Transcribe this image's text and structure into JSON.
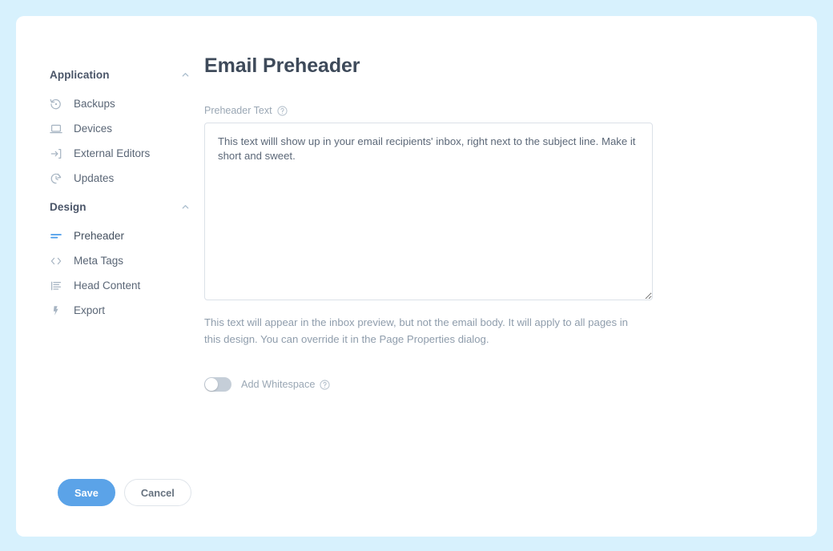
{
  "theme": {
    "page_background": "#d7f1fd",
    "card_background": "#ffffff",
    "accent_blue": "#5ba3e8",
    "active_icon_blue": "#4a9bea",
    "text_dark": "#3e4a5a",
    "text_muted": "#9aa7b4",
    "border": "#dbe1e8",
    "toggle_off": "#c5ced8"
  },
  "sidebar": {
    "sections": [
      {
        "title": "Application",
        "collapse_icon": "chevron-up-icon",
        "items": [
          {
            "label": "Backups",
            "icon": "restore-clock-icon",
            "active": false
          },
          {
            "label": "Devices",
            "icon": "laptop-icon",
            "active": false
          },
          {
            "label": "External Editors",
            "icon": "arrow-into-box-icon",
            "active": false
          },
          {
            "label": "Updates",
            "icon": "clock-refresh-icon",
            "active": false
          }
        ]
      },
      {
        "title": "Design",
        "collapse_icon": "chevron-up-icon",
        "items": [
          {
            "label": "Preheader",
            "icon": "preheader-lines-icon",
            "active": true
          },
          {
            "label": "Meta Tags",
            "icon": "code-brackets-icon",
            "active": false
          },
          {
            "label": "Head Content",
            "icon": "text-lines-icon",
            "active": false
          },
          {
            "label": "Export",
            "icon": "export-bolt-icon",
            "active": false
          }
        ]
      }
    ]
  },
  "main": {
    "title": "Email Preheader",
    "field": {
      "label": "Preheader Text",
      "help_icon": "question-circle-icon",
      "value": "This text willl show up in your email recipients' inbox, right next to the subject line. Make it short and sweet.",
      "placeholder": ""
    },
    "helper_text": "This text will appear in the inbox preview, but not the email body. It will apply to all pages in this design. You can override it in the Page Properties dialog.",
    "whitespace_toggle": {
      "label": "Add Whitespace",
      "help_icon": "question-circle-icon",
      "enabled": false
    }
  },
  "footer": {
    "save_label": "Save",
    "cancel_label": "Cancel"
  }
}
